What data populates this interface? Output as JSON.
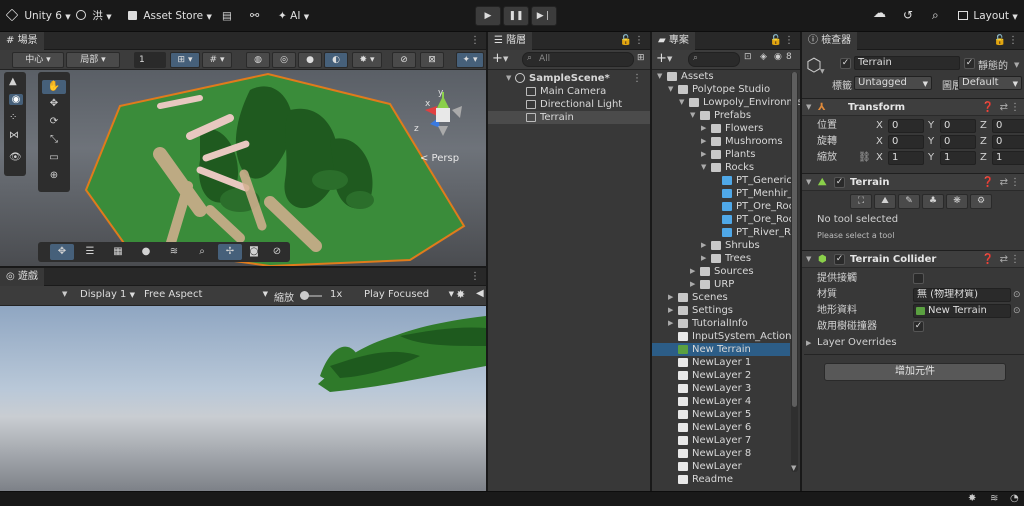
{
  "topbar": {
    "account_label": "Unity 6",
    "user_label": "洪",
    "asset_store_label": "Asset Store",
    "ai_label": "AI",
    "layout_label": "Layout"
  },
  "scene": {
    "tab_label": "場景",
    "pivot_label": "中心",
    "local_label": "局部",
    "grid_value": "1",
    "persp_label": "< Persp",
    "gizmo_axes": [
      "y",
      "x",
      "z"
    ]
  },
  "game": {
    "tab_label": "遊戲",
    "display_label": "Display 1",
    "aspect_label": "Free Aspect",
    "scale_label": "縮放",
    "scale_value": "1x",
    "play_mode_label": "Play Focused"
  },
  "hierarchy": {
    "tab_label": "階層",
    "search_placeholder": "All",
    "scene_name": "SampleScene*",
    "items": [
      "Main Camera",
      "Directional Light",
      "Terrain"
    ]
  },
  "project": {
    "tab_label": "專案",
    "badge_count": "8",
    "tree": [
      {
        "label": "Assets",
        "depth": 0,
        "kind": "folder",
        "arrow": "open"
      },
      {
        "label": "Polytope Studio",
        "depth": 1,
        "kind": "folder",
        "arrow": "open"
      },
      {
        "label": "Lowpoly_Environme",
        "depth": 2,
        "kind": "folder",
        "arrow": "open"
      },
      {
        "label": "Prefabs",
        "depth": 3,
        "kind": "folder",
        "arrow": "open"
      },
      {
        "label": "Flowers",
        "depth": 4,
        "kind": "folder",
        "arrow": "closed"
      },
      {
        "label": "Mushrooms",
        "depth": 4,
        "kind": "folder",
        "arrow": "closed"
      },
      {
        "label": "Plants",
        "depth": 4,
        "kind": "folder",
        "arrow": "closed"
      },
      {
        "label": "Rocks",
        "depth": 4,
        "kind": "folder",
        "arrow": "open"
      },
      {
        "label": "PT_Generic",
        "depth": 5,
        "kind": "prefab",
        "arrow": "none"
      },
      {
        "label": "PT_Menhir_",
        "depth": 5,
        "kind": "prefab",
        "arrow": "none"
      },
      {
        "label": "PT_Ore_Roc",
        "depth": 5,
        "kind": "prefab",
        "arrow": "none"
      },
      {
        "label": "PT_Ore_Roc",
        "depth": 5,
        "kind": "prefab",
        "arrow": "none"
      },
      {
        "label": "PT_River_Ro",
        "depth": 5,
        "kind": "prefab",
        "arrow": "none"
      },
      {
        "label": "Shrubs",
        "depth": 4,
        "kind": "folder",
        "arrow": "closed"
      },
      {
        "label": "Trees",
        "depth": 4,
        "kind": "folder",
        "arrow": "closed"
      },
      {
        "label": "Sources",
        "depth": 3,
        "kind": "folder",
        "arrow": "closed"
      },
      {
        "label": "URP",
        "depth": 3,
        "kind": "folder",
        "arrow": "closed"
      },
      {
        "label": "Scenes",
        "depth": 1,
        "kind": "folder",
        "arrow": "closed"
      },
      {
        "label": "Settings",
        "depth": 1,
        "kind": "folder",
        "arrow": "closed"
      },
      {
        "label": "TutorialInfo",
        "depth": 1,
        "kind": "folder",
        "arrow": "closed"
      },
      {
        "label": "InputSystem_Actions",
        "depth": 1,
        "kind": "file",
        "arrow": "none"
      },
      {
        "label": "New Terrain",
        "depth": 1,
        "kind": "terrain",
        "arrow": "none"
      },
      {
        "label": "NewLayer 1",
        "depth": 1,
        "kind": "file",
        "arrow": "none"
      },
      {
        "label": "NewLayer 2",
        "depth": 1,
        "kind": "file",
        "arrow": "none"
      },
      {
        "label": "NewLayer 3",
        "depth": 1,
        "kind": "file",
        "arrow": "none"
      },
      {
        "label": "NewLayer 4",
        "depth": 1,
        "kind": "file",
        "arrow": "none"
      },
      {
        "label": "NewLayer 5",
        "depth": 1,
        "kind": "file",
        "arrow": "none"
      },
      {
        "label": "NewLayer 6",
        "depth": 1,
        "kind": "file",
        "arrow": "none"
      },
      {
        "label": "NewLayer 7",
        "depth": 1,
        "kind": "file",
        "arrow": "none"
      },
      {
        "label": "NewLayer 8",
        "depth": 1,
        "kind": "file",
        "arrow": "none"
      },
      {
        "label": "NewLayer",
        "depth": 1,
        "kind": "file",
        "arrow": "none"
      },
      {
        "label": "Readme",
        "depth": 1,
        "kind": "file",
        "arrow": "none"
      }
    ]
  },
  "inspector": {
    "tab_label": "檢查器",
    "object_name": "Terrain",
    "static_label": "靜態的",
    "tag_label": "標籤",
    "tag_value": "Untagged",
    "layer_label": "圖層",
    "layer_value": "Default",
    "transform": {
      "title": "Transform",
      "rows": [
        {
          "label": "位置",
          "x": "0",
          "y": "0",
          "z": "0"
        },
        {
          "label": "旋轉",
          "x": "0",
          "y": "0",
          "z": "0"
        },
        {
          "label": "縮放",
          "x": "1",
          "y": "1",
          "z": "1"
        }
      ]
    },
    "terrain": {
      "title": "Terrain",
      "no_tool": "No tool selected",
      "hint": "Please select a tool"
    },
    "collider": {
      "title": "Terrain Collider",
      "trigger_label": "提供接觸",
      "material_label": "材質",
      "material_value": "無 (物理材質)",
      "terrain_data_label": "地形資料",
      "terrain_data_value": "New Terrain",
      "tree_colliders_label": "啟用樹碰撞器",
      "layer_overrides_label": "Layer Overrides"
    },
    "add_component_label": "增加元件"
  },
  "colors": {
    "terrain_green": "#3a8c3a",
    "selection_blue": "#2c5d87",
    "accent_orange": "#e07b1c",
    "prefab_blue": "#4fa8e8"
  }
}
